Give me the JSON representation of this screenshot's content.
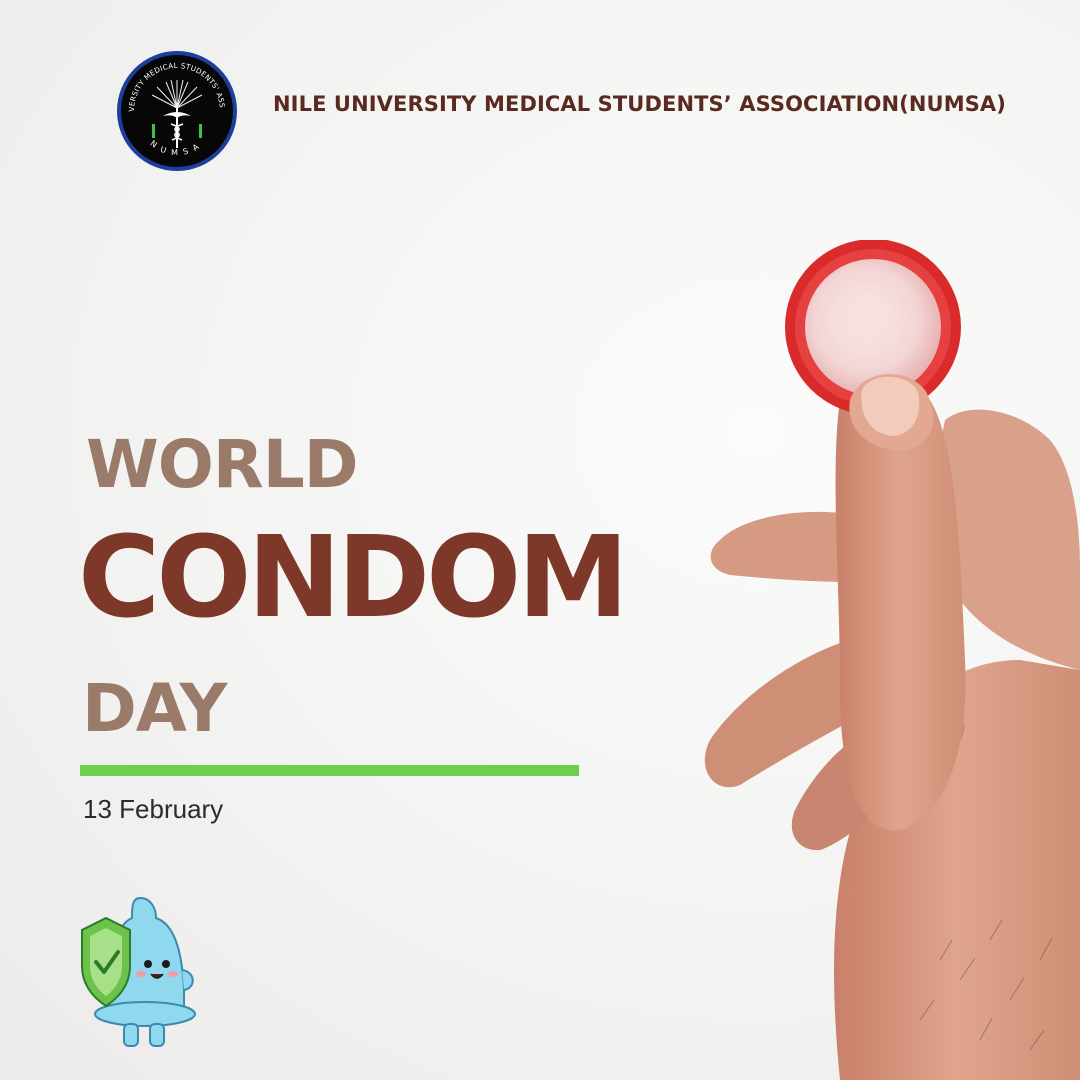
{
  "logo": {
    "ring_text_top": "NILE UNIVERSITY MEDICAL STUDENTS' ASSOCIATION",
    "ring_text_bottom": "NUMSA"
  },
  "header": {
    "org_name": "NILE UNIVERSITY MEDICAL STUDENTS’ ASSOCIATION(NUMSA)"
  },
  "title": {
    "line1": "WORLD",
    "line2": "CONDOM",
    "line3": "DAY"
  },
  "date": "13 February",
  "colors": {
    "background": "#f3f3f2",
    "header_text": "#5a2a20",
    "title_light": "#9a7a68",
    "title_dark": "#7d382a",
    "accent_line": "#6cd04f",
    "condom_red": "#d92b2b",
    "mascot_blue": "#8fd8ee",
    "shield_green": "#6cc24a"
  },
  "icons": {
    "logo": "caduceus-emblem-icon",
    "mascot": "condom-mascot-icon",
    "shield": "shield-check-icon",
    "photo": "hand-holding-condom"
  }
}
